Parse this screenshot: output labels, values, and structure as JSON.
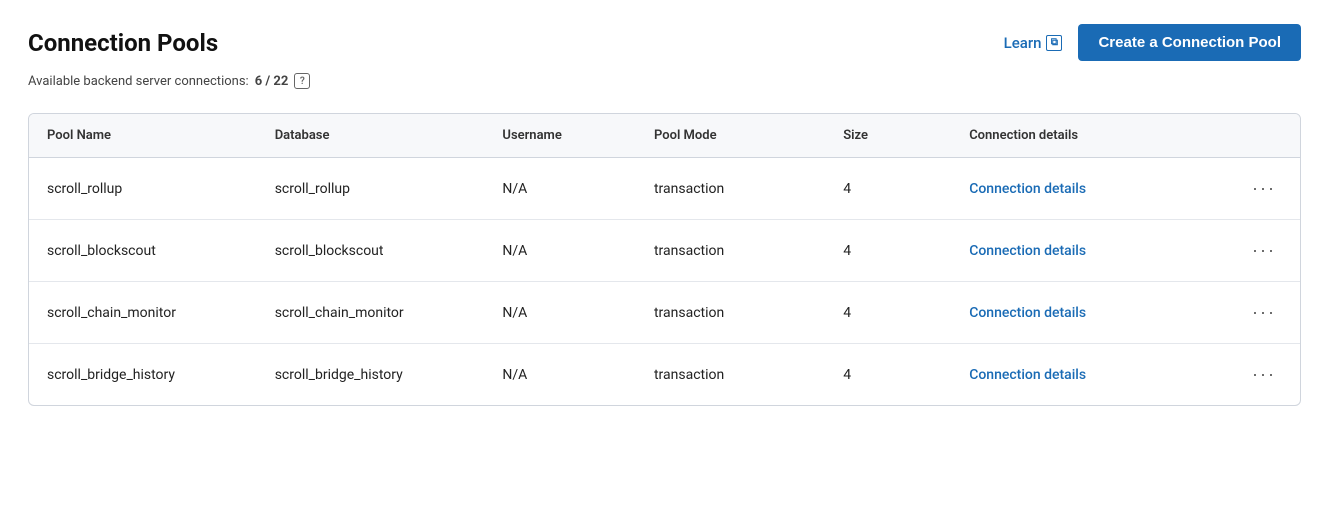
{
  "page": {
    "title": "Connection Pools",
    "subtitle_text": "Available backend server connections:",
    "subtitle_value": "6 / 22",
    "help_icon_label": "?",
    "learn_label": "Learn",
    "learn_icon": "↗",
    "create_button_label": "Create a Connection Pool"
  },
  "table": {
    "columns": [
      {
        "key": "pool_name",
        "label": "Pool Name"
      },
      {
        "key": "database",
        "label": "Database"
      },
      {
        "key": "username",
        "label": "Username"
      },
      {
        "key": "pool_mode",
        "label": "Pool Mode"
      },
      {
        "key": "size",
        "label": "Size"
      },
      {
        "key": "connection_details",
        "label": "Connection details"
      }
    ],
    "rows": [
      {
        "pool_name": "scroll_rollup",
        "database": "scroll_rollup",
        "username": "N/A",
        "pool_mode": "transaction",
        "size": "4",
        "connection_details_label": "Connection details"
      },
      {
        "pool_name": "scroll_blockscout",
        "database": "scroll_blockscout",
        "username": "N/A",
        "pool_mode": "transaction",
        "size": "4",
        "connection_details_label": "Connection details"
      },
      {
        "pool_name": "scroll_chain_monitor",
        "database": "scroll_chain_monitor",
        "username": "N/A",
        "pool_mode": "transaction",
        "size": "4",
        "connection_details_label": "Connection details"
      },
      {
        "pool_name": "scroll_bridge_history",
        "database": "scroll_bridge_history",
        "username": "N/A",
        "pool_mode": "transaction",
        "size": "4",
        "connection_details_label": "Connection details"
      }
    ]
  },
  "colors": {
    "accent": "#1a6bb5",
    "border": "#d0d5dd",
    "header_bg": "#f7f8fa"
  }
}
